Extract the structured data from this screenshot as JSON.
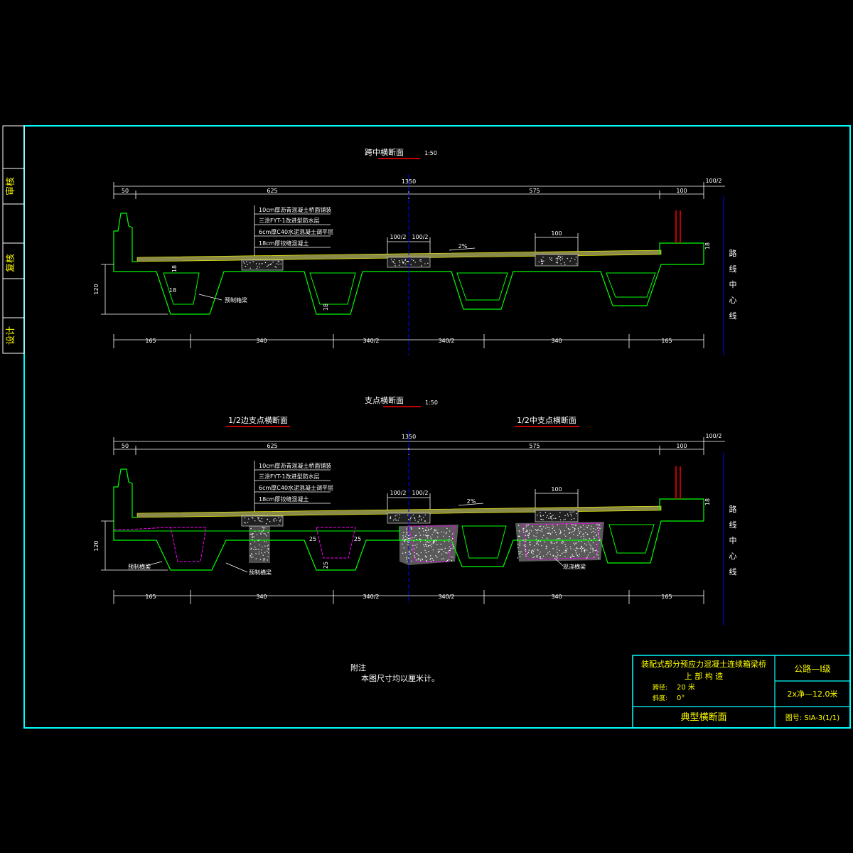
{
  "colors": {
    "frame": "#00ffff",
    "outline": "#00ff00",
    "text": "#ffffff",
    "title": "#ffff00",
    "centerline": "#0000ff",
    "hidden": "#ff00ff",
    "underline": "#ff0000"
  },
  "side_stamp": {
    "review": "审核",
    "recheck": "复核",
    "design": "设计"
  },
  "section1": {
    "title": "跨中横断面",
    "scale": "1:50",
    "top_dims": {
      "total": "1350",
      "right_half": "100/2",
      "d1": "50",
      "d2": "625",
      "d3": "575",
      "d4": "100"
    },
    "layers": [
      "10cm厚沥青混凝土桥面铺装",
      "三涂FYT-1改进型防水层",
      "6cm厚C40水泥混凝土调平层",
      "18cm厚铰缝混凝土"
    ],
    "joint_dims": [
      "100/2",
      "100/2",
      "100"
    ],
    "slope": "2%",
    "thickness": "18",
    "height": "120",
    "web": "18",
    "web2": "18",
    "bottom_flange": "18",
    "beam_label": "预制箱梁",
    "bottom_dims": [
      "165",
      "340",
      "340/2",
      "340/2",
      "340",
      "165"
    ],
    "centerline": [
      "路",
      "线",
      "中",
      "心",
      "线"
    ]
  },
  "section2": {
    "title": "支点横断面",
    "scale": "1:50",
    "left_sub": "1/2边支点横断面",
    "right_sub": "1/2中支点横断面",
    "top_dims": {
      "total": "1350",
      "right_half": "100/2",
      "d1": "50",
      "d2": "625",
      "d3": "575",
      "d4": "100"
    },
    "layers": [
      "10cm厚沥青混凝土桥面铺装",
      "三涂FYT-1改进型防水层",
      "6cm厚C40水泥混凝土调平层",
      "18cm厚铰缝混凝土"
    ],
    "joint_dims": [
      "100/2",
      "100/2",
      "100"
    ],
    "slope": "2%",
    "thickness": "18",
    "height": "120",
    "d25a": "25",
    "d25b": "25",
    "d25c": "25",
    "label_a": "预制横梁",
    "label_b": "预制横梁",
    "label_c": "现浇横梁",
    "bottom_dims": [
      "165",
      "340",
      "340/2",
      "340/2",
      "340",
      "165"
    ],
    "centerline": [
      "路",
      "线",
      "中",
      "心",
      "线"
    ]
  },
  "notes": {
    "head": "附注",
    "body": "本图尺寸均以厘米计。"
  },
  "title_block": {
    "project": "装配式部分预应力混凝土连续箱梁桥",
    "part": "上 部 构 造",
    "span_label": "跨径:",
    "span_value": "20 米",
    "skew_label": "斜度:",
    "skew_value": "0°",
    "drawing": "典型横断面",
    "grade": "公路—I级",
    "width": "2x净—12.0米",
    "sheet": "图号: SIA-3(1/1)"
  }
}
